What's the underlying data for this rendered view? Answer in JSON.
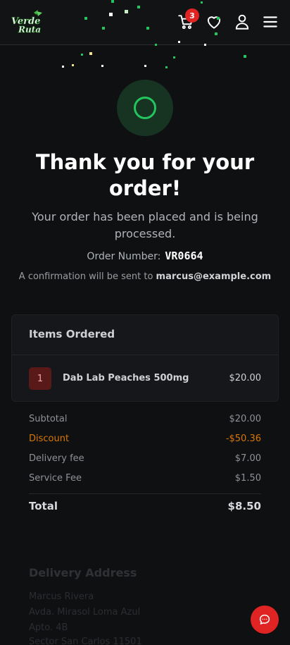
{
  "header": {
    "logo_text": "Verde Ruta",
    "cart_count": "3",
    "icons": [
      "cart-icon",
      "heart-icon",
      "user-icon",
      "menu-icon"
    ]
  },
  "confirmation": {
    "title": "Thank you for your order!",
    "subtitle": "Your order has been placed and is being processed.",
    "order_number_label": "Order Number:",
    "order_number": "VR0664",
    "confirm_text": "A confirmation will be sent to",
    "email": "marcus@example.com"
  },
  "items": {
    "title": "Items Ordered",
    "list": [
      {
        "qty": "1",
        "name": "Dab Lab Peaches 500mg",
        "price": "$20.00"
      }
    ]
  },
  "summary": {
    "subtotal_label": "Subtotal",
    "subtotal": "$20.00",
    "discount_label": "Discount",
    "discount": "-$50.36",
    "delivery_label": "Delivery fee",
    "delivery": "$7.00",
    "service_label": "Service Fee",
    "service": "$1.50",
    "total_label": "Total",
    "total": "$8.50"
  },
  "address": {
    "title": "Delivery Address",
    "lines": [
      "Marcus Rivera",
      "Avda. Mirasol Loma Azul",
      "Apto. 4B",
      "Sector San Carlos 11501"
    ]
  },
  "colors": {
    "accent_green": "#22c55e",
    "badge_red": "#e02424",
    "discount_orange": "#d97706"
  }
}
